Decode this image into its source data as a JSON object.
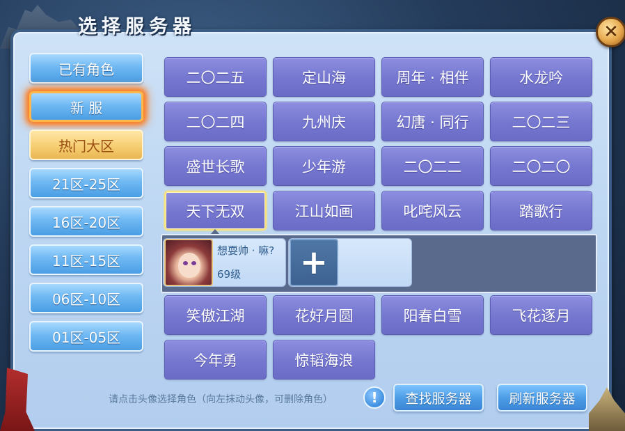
{
  "window": {
    "title": "选择服务器",
    "close_label": "✕"
  },
  "sidebar": {
    "items": [
      {
        "label": "已有角色",
        "state": "normal"
      },
      {
        "label": "新 服",
        "state": "selected"
      },
      {
        "label": "热门大区",
        "state": "highlight"
      },
      {
        "label": "21区-25区",
        "state": "normal"
      },
      {
        "label": "16区-20区",
        "state": "normal"
      },
      {
        "label": "11区-15区",
        "state": "normal"
      },
      {
        "label": "06区-10区",
        "state": "normal"
      },
      {
        "label": "01区-05区",
        "state": "normal"
      }
    ]
  },
  "servers": {
    "rows_top": [
      [
        "二〇二五",
        "定山海",
        "周年 · 相伴",
        "水龙吟"
      ],
      [
        "二〇二四",
        "九州庆",
        "幻唐 · 同行",
        "二〇二三"
      ],
      [
        "盛世长歌",
        "少年游",
        "二〇二二",
        "二〇二〇"
      ],
      [
        "天下无双",
        "江山如画",
        "叱咤风云",
        "踏歌行"
      ]
    ],
    "active": "天下无双",
    "rows_bottom": [
      [
        "笑傲江湖",
        "花好月圆",
        "阳春白雪",
        "飞花逐月"
      ],
      [
        "今年勇",
        "惊韬海浪"
      ]
    ]
  },
  "role_panel": {
    "role": {
      "name": "想耍帅 · 嘛?",
      "level": "69级",
      "avatar_icon": "female-character-avatar"
    },
    "add_label": "+"
  },
  "footer": {
    "hint": "请点击头像选择角色（向左抹动头像，可删除角色）",
    "hint_icon": "!",
    "find_label": "查找服务器",
    "refresh_label": "刷新服务器"
  },
  "colors": {
    "server_button": "#7476cf",
    "sidebar_button": "#6fb8f2",
    "hot_zone_button": "#f5cc6e",
    "selected_glow": "#ff7a1a",
    "active_border": "#f7e27d"
  }
}
